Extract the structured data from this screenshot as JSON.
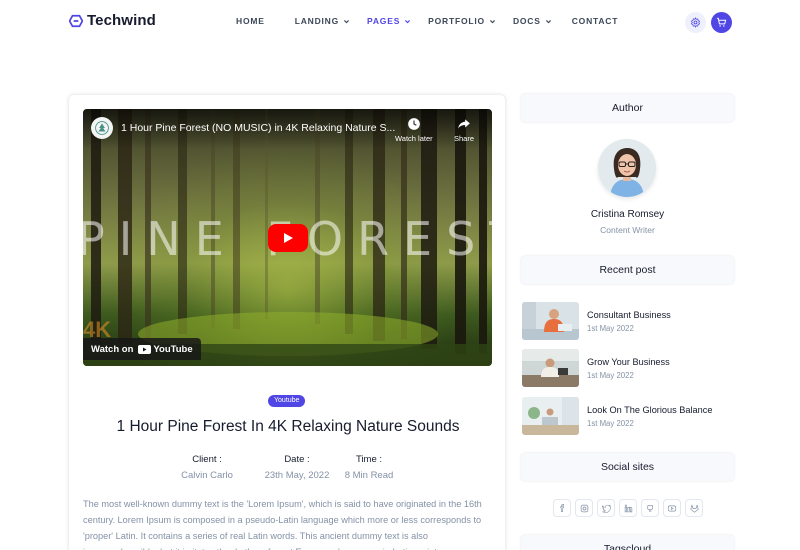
{
  "brand": {
    "name": "Techwind",
    "accent": "#4f46e5"
  },
  "nav": {
    "items": [
      {
        "label": "HOME",
        "dropdown": false,
        "active": false
      },
      {
        "label": "LANDING",
        "dropdown": true,
        "active": false
      },
      {
        "label": "PAGES",
        "dropdown": true,
        "active": true
      },
      {
        "label": "PORTFOLIO",
        "dropdown": true,
        "active": false
      },
      {
        "label": "DOCS",
        "dropdown": true,
        "active": false
      },
      {
        "label": "CONTACT",
        "dropdown": false,
        "active": false
      }
    ],
    "icons": [
      "gear-icon",
      "cart-icon"
    ]
  },
  "video": {
    "title": "1 Hour Pine Forest (NO MUSIC) in 4K Relaxing Nature S...",
    "watch_later": "Watch later",
    "share": "Share",
    "overlay_text": "PINE FOREST",
    "corner_text": "4K",
    "watch_on": "Watch on",
    "youtube": "YouTube"
  },
  "post": {
    "badge": "Youtube",
    "title": "1 Hour Pine Forest In 4K Relaxing Nature Sounds",
    "meta": {
      "client_label": "Client :",
      "client_value": "Calvin Carlo",
      "date_label": "Date :",
      "date_value": "23th May, 2022",
      "time_label": "Time :",
      "time_value": "8 Min Read"
    },
    "body": "The most well-known dummy text is the 'Lorem Ipsum', which is said to have originated in the 16th century. Lorem Ipsum is composed in a pseudo-Latin language which more or less corresponds to 'proper' Latin. It contains a series of real Latin words. This ancient dummy text is also incomprehensible, but it imitates the rhythm of most European languages in Latin script."
  },
  "sidebar": {
    "author_heading": "Author",
    "author_name": "Cristina Romsey",
    "author_role": "Content Writer",
    "recent_heading": "Recent post",
    "recent": [
      {
        "title": "Consultant Business",
        "date": "1st May 2022"
      },
      {
        "title": "Grow Your Business",
        "date": "1st May 2022"
      },
      {
        "title": "Look On The Glorious Balance",
        "date": "1st May 2022"
      }
    ],
    "social_heading": "Social sites",
    "social_icons": [
      "facebook-icon",
      "instagram-icon",
      "twitter-icon",
      "linkedin-icon",
      "github-icon",
      "youtube-icon",
      "gitlab-icon"
    ],
    "tags_heading": "Tagscloud"
  }
}
